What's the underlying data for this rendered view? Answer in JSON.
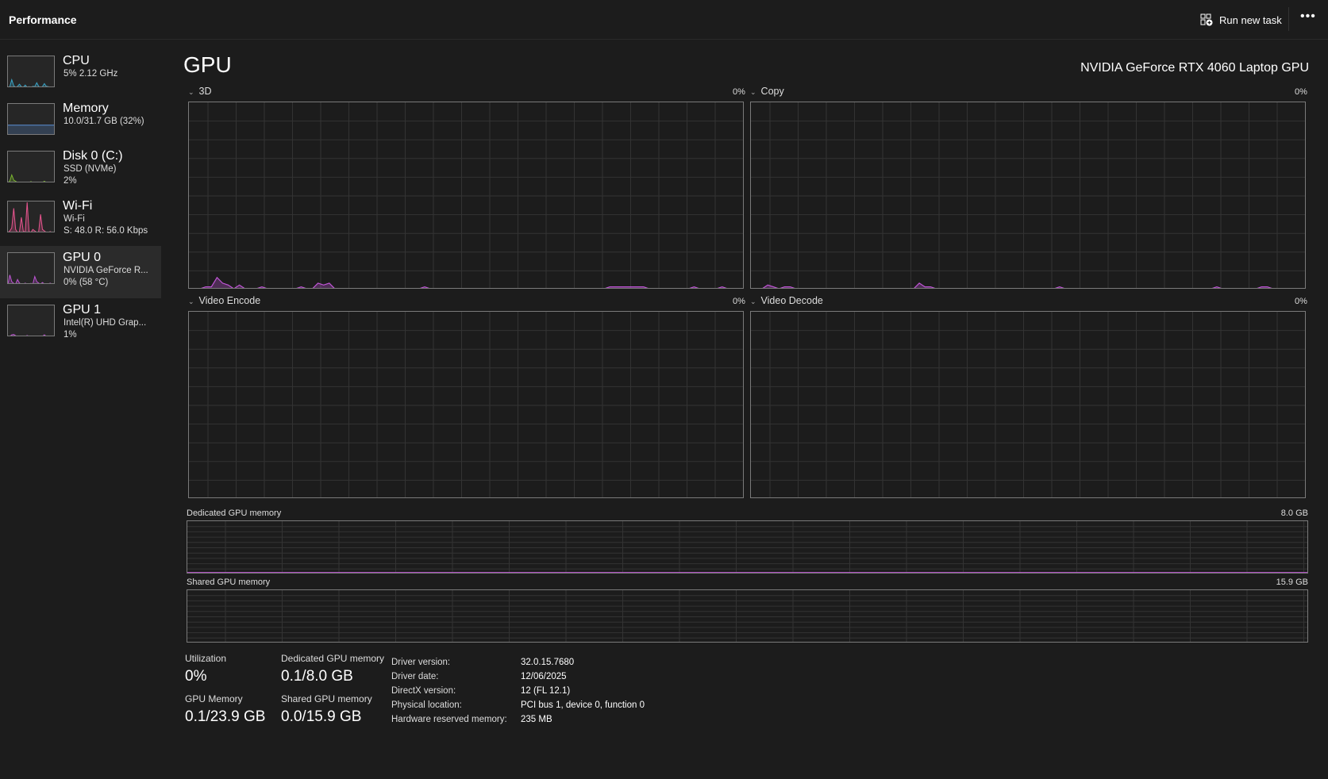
{
  "header": {
    "title": "Performance",
    "run_new_task": "Run new task",
    "more": "•••"
  },
  "sidebar": {
    "items": [
      {
        "name": "CPU",
        "line1": "5% 2.12 GHz",
        "line2": "",
        "color": "#3aa6c9",
        "history": [
          0,
          2,
          25,
          5,
          0,
          3,
          10,
          2,
          0,
          7,
          0,
          2,
          0,
          3,
          2,
          15,
          3,
          0,
          2,
          12,
          3,
          2,
          0,
          1,
          0
        ]
      },
      {
        "name": "Memory",
        "line1": "10.0/31.7 GB (32%)",
        "line2": "",
        "color": "#5b8fd6",
        "history": [
          32,
          32,
          32,
          32,
          32,
          32,
          32,
          32,
          32,
          32,
          32,
          32,
          32,
          32,
          32,
          32,
          32,
          32,
          32,
          32,
          32,
          32,
          32,
          32,
          32
        ]
      },
      {
        "name": "Disk 0 (C:)",
        "line1": "SSD (NVMe)",
        "line2": "2%",
        "color": "#7cb82f",
        "history": [
          0,
          5,
          25,
          8,
          4,
          0,
          0,
          0,
          0,
          0,
          0,
          0,
          3,
          0,
          0,
          0,
          0,
          0,
          0,
          4,
          0,
          0,
          0,
          0,
          0
        ]
      },
      {
        "name": "Wi-Fi",
        "line1": "Wi-Fi",
        "line2": "S: 48.0  R: 56.0 Kbps",
        "color": "#e9558f",
        "history": [
          0,
          5,
          15,
          80,
          10,
          0,
          2,
          50,
          5,
          0,
          100,
          3,
          0,
          10,
          5,
          0,
          2,
          60,
          10,
          5,
          0,
          0,
          3,
          0,
          0
        ]
      },
      {
        "name": "GPU 0",
        "line1": "NVIDIA GeForce R...",
        "line2": "0%  (58 °C)",
        "color": "#c055d6",
        "history": [
          0,
          30,
          8,
          2,
          0,
          15,
          3,
          0,
          0,
          3,
          0,
          0,
          2,
          0,
          25,
          8,
          3,
          0,
          5,
          0,
          1,
          0,
          3,
          0,
          0
        ],
        "selected": true
      },
      {
        "name": "GPU 1",
        "line1": "Intel(R) UHD Grap...",
        "line2": "1%",
        "color": "#c055d6",
        "history": [
          0,
          0,
          5,
          6,
          2,
          0,
          0,
          0,
          0,
          0,
          3,
          0,
          0,
          0,
          0,
          0,
          0,
          0,
          0,
          5,
          0,
          0,
          0,
          0,
          0
        ]
      }
    ]
  },
  "main": {
    "title": "GPU",
    "gpu_name": "NVIDIA GeForce RTX 4060 Laptop GPU",
    "accent": "#c055d6",
    "engines": [
      {
        "label": "3D",
        "pct": "0%",
        "history": [
          0,
          0,
          0,
          1,
          1,
          6,
          3,
          2,
          0,
          2,
          0,
          0,
          0,
          1,
          0,
          0,
          0,
          0,
          0,
          0,
          1,
          0,
          0,
          3,
          2,
          3,
          0,
          0,
          0,
          0,
          0,
          0,
          0,
          0,
          0,
          0,
          0,
          0,
          0,
          0,
          0,
          0,
          1,
          0,
          0,
          0,
          0,
          0,
          0,
          0,
          0,
          0,
          0,
          0,
          0,
          0,
          0,
          0,
          0,
          0,
          0,
          0,
          0,
          0,
          0,
          0,
          0,
          0,
          0,
          0,
          0,
          0,
          0,
          0,
          0,
          1,
          1,
          1,
          1,
          1,
          1,
          1,
          0,
          0,
          0,
          0,
          0,
          0,
          0,
          0,
          1,
          0,
          0,
          0,
          0,
          1,
          0,
          0,
          0,
          0
        ]
      },
      {
        "label": "Copy",
        "pct": "0%",
        "history": [
          0,
          0,
          0,
          2,
          1,
          0,
          1,
          1,
          0,
          0,
          0,
          0,
          0,
          0,
          0,
          0,
          0,
          0,
          0,
          0,
          0,
          0,
          0,
          0,
          0,
          0,
          0,
          0,
          0,
          0,
          3,
          1,
          1,
          0,
          0,
          0,
          0,
          0,
          0,
          0,
          0,
          0,
          0,
          0,
          0,
          0,
          0,
          0,
          0,
          0,
          0,
          0,
          0,
          0,
          0,
          1,
          0,
          0,
          0,
          0,
          0,
          0,
          0,
          0,
          0,
          0,
          0,
          0,
          0,
          0,
          0,
          0,
          0,
          0,
          0,
          0,
          0,
          0,
          0,
          0,
          0,
          0,
          0,
          1,
          0,
          0,
          0,
          0,
          0,
          0,
          0,
          1,
          1,
          0,
          0,
          0,
          0,
          0,
          0,
          0
        ]
      },
      {
        "label": "Video Encode",
        "pct": "0%",
        "history": []
      },
      {
        "label": "Video Decode",
        "pct": "0%",
        "history": []
      }
    ],
    "dedicated": {
      "label": "Dedicated GPU memory",
      "max": "8.0 GB",
      "fraction": 0.0125
    },
    "shared": {
      "label": "Shared GPU memory",
      "max": "15.9 GB",
      "fraction": 0.0
    }
  },
  "stats": {
    "utilization_label": "Utilization",
    "utilization": "0%",
    "dedicated_label": "Dedicated GPU memory",
    "dedicated": "0.1/8.0 GB",
    "gpu_memory_label": "GPU Memory",
    "gpu_memory": "0.1/23.9 GB",
    "shared_label": "Shared GPU memory",
    "shared": "0.0/15.9 GB"
  },
  "details": [
    {
      "k": "Driver version:",
      "v": "32.0.15.7680"
    },
    {
      "k": "Driver date:",
      "v": "12/06/2025"
    },
    {
      "k": "DirectX version:",
      "v": "12 (FL 12.1)"
    },
    {
      "k": "Physical location:",
      "v": "PCI bus 1, device 0, function 0"
    },
    {
      "k": "Hardware reserved memory:",
      "v": "235 MB"
    }
  ]
}
